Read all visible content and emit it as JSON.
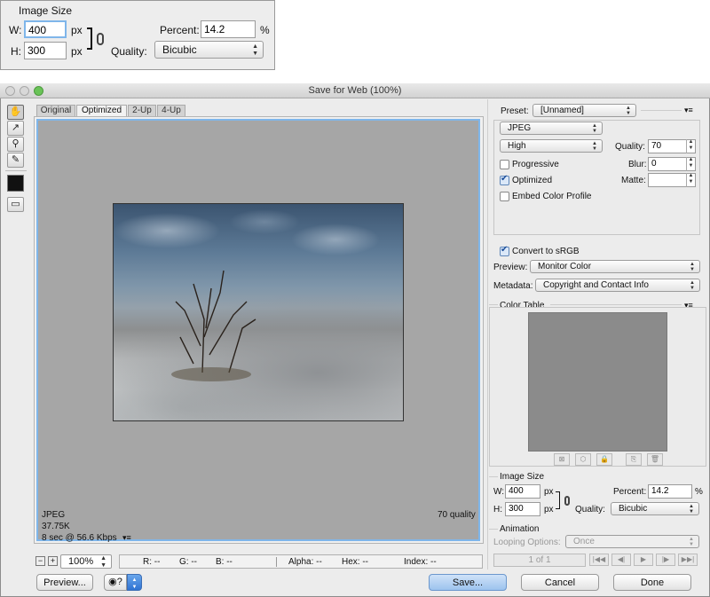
{
  "top_panel": {
    "title": "Image Size",
    "w_label": "W:",
    "w_value": "400",
    "w_unit": "px",
    "h_label": "H:",
    "h_value": "300",
    "h_unit": "px",
    "percent_label": "Percent:",
    "percent_value": "14.2",
    "percent_unit": "%",
    "quality_label": "Quality:",
    "quality_value": "Bicubic"
  },
  "window": {
    "title": "Save for Web (100%)",
    "tabs": [
      "Original",
      "Optimized",
      "2-Up",
      "4-Up"
    ],
    "active_tab": "Optimized"
  },
  "preview_info": {
    "format": "JPEG",
    "size": "37.75K",
    "speed": "8 sec @ 56.6 Kbps",
    "quality": "70 quality"
  },
  "status_bar": {
    "zoom": "100%",
    "r": "R: --",
    "g": "G: --",
    "b": "B: --",
    "alpha": "Alpha: --",
    "hex": "Hex: --",
    "index": "Index: --"
  },
  "settings": {
    "preset_label": "Preset:",
    "preset_value": "[Unnamed]",
    "format_value": "JPEG",
    "quality_preset": "High",
    "quality_label": "Quality:",
    "quality_value": "70",
    "progressive_label": "Progressive",
    "progressive_checked": false,
    "blur_label": "Blur:",
    "blur_value": "0",
    "optimized_label": "Optimized",
    "optimized_checked": true,
    "matte_label": "Matte:",
    "embed_label": "Embed Color Profile",
    "embed_checked": false,
    "convert_label": "Convert to sRGB",
    "convert_checked": true,
    "preview_label": "Preview:",
    "preview_value": "Monitor Color",
    "metadata_label": "Metadata:",
    "metadata_value": "Copyright and Contact Info"
  },
  "color_table": {
    "title": "Color Table"
  },
  "image_size": {
    "title": "Image Size",
    "w_label": "W:",
    "w_value": "400",
    "w_unit": "px",
    "h_label": "H:",
    "h_value": "300",
    "h_unit": "px",
    "percent_label": "Percent:",
    "percent_value": "14.2",
    "percent_unit": "%",
    "quality_label": "Quality:",
    "quality_value": "Bicubic"
  },
  "animation": {
    "title": "Animation",
    "looping_label": "Looping Options:",
    "looping_value": "Once",
    "frame_counter": "1 of 1"
  },
  "buttons": {
    "preview": "Preview...",
    "save": "Save...",
    "cancel": "Cancel",
    "done": "Done"
  },
  "colors": {
    "accent": "#7fb6ea",
    "canvas_gray": "#a6a6a6",
    "panel_bg": "#ececec",
    "save_button": "#b9d4f2"
  },
  "icons": [
    "hand-icon",
    "slice-select-icon",
    "zoom-icon",
    "eyedropper-icon",
    "eyedropper-color-swatch",
    "toggle-slices-icon",
    "chain-link-icon",
    "panel-menu-icon",
    "help-icon"
  ]
}
